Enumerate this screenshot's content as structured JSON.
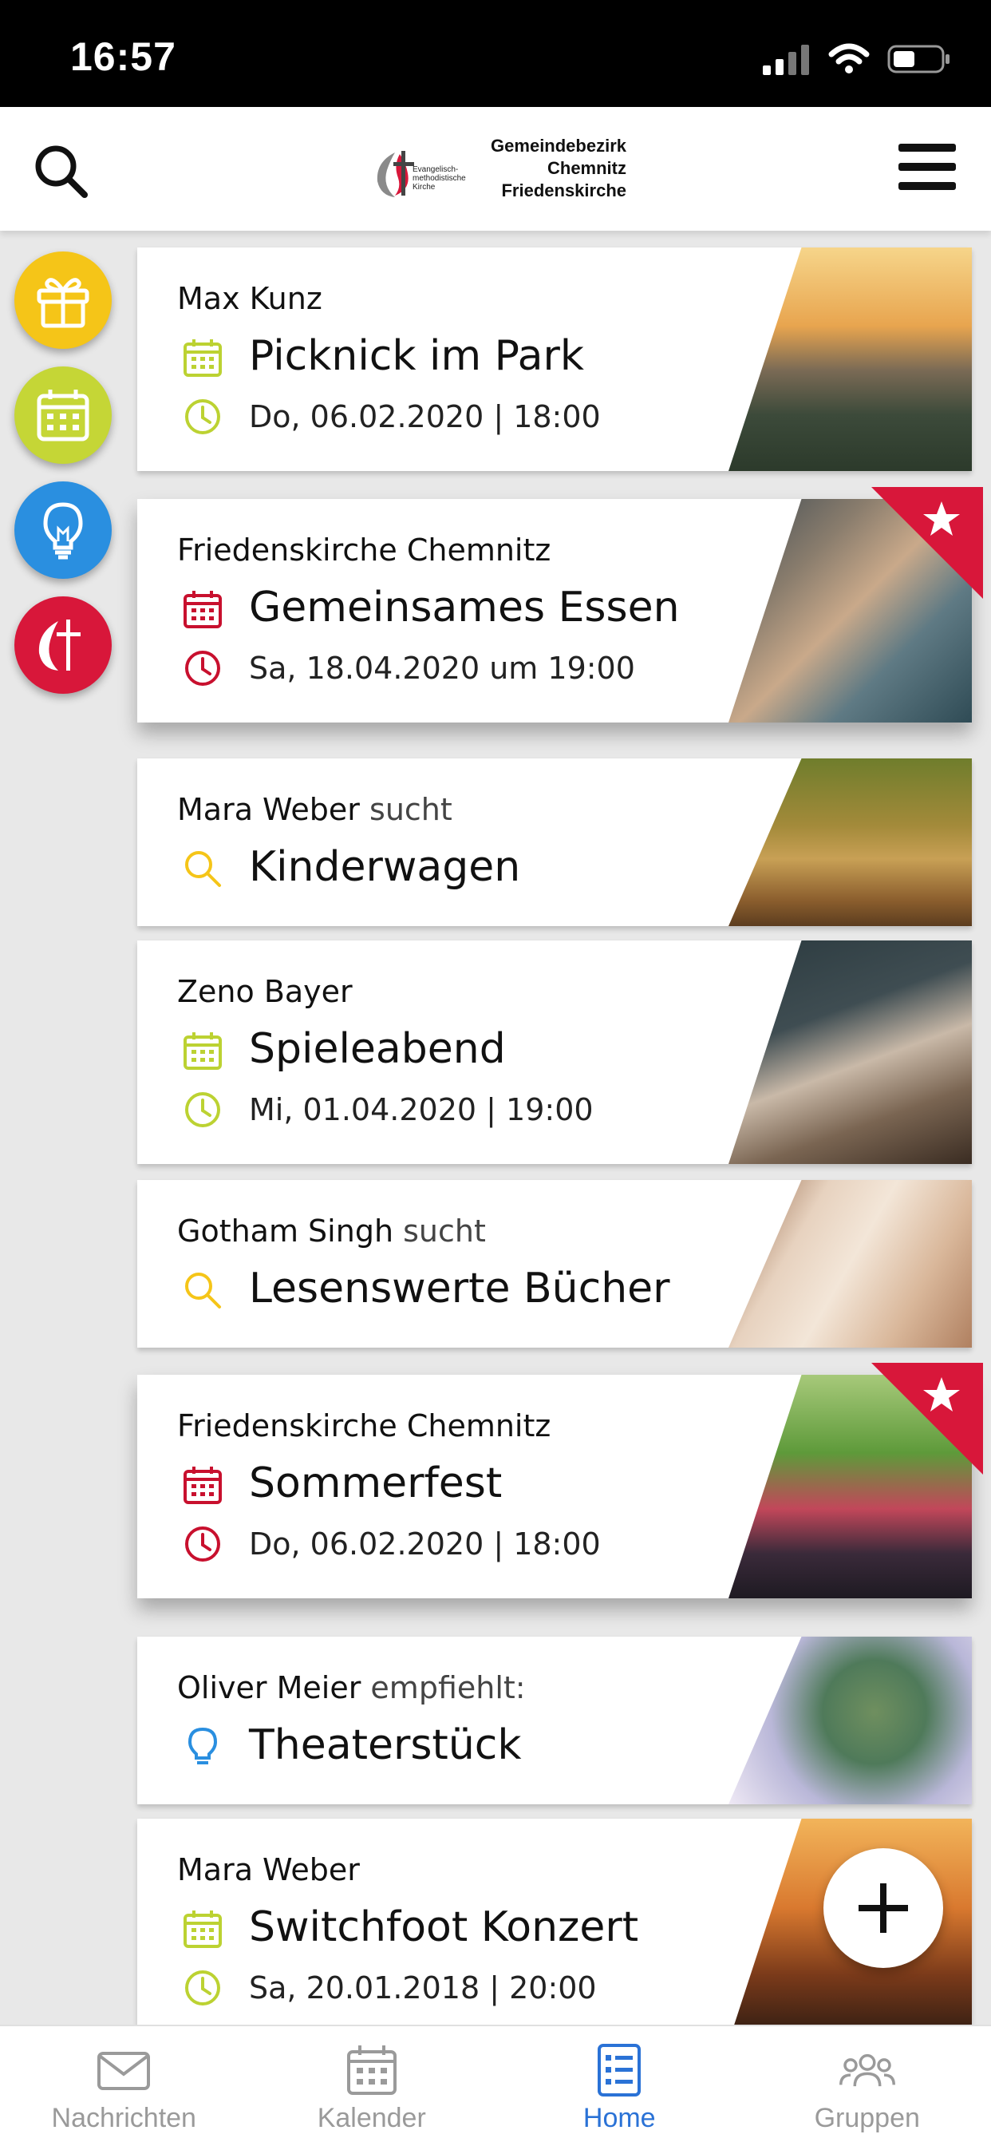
{
  "status": {
    "time": "16:57"
  },
  "header": {
    "logo_small": "Evangelisch-methodistische Kirche",
    "logo_line1": "Gemeindebezirk",
    "logo_line2": "Chemnitz",
    "logo_line3": "Friedenskirche"
  },
  "sidebar": {
    "items": [
      {
        "icon": "gift-icon",
        "color": "#f5c518"
      },
      {
        "icon": "calendar-icon",
        "color": "#c5d636"
      },
      {
        "icon": "lightbulb-icon",
        "color": "#2a8fe0"
      },
      {
        "icon": "church-cross-icon",
        "color": "#d8173a"
      }
    ]
  },
  "colors": {
    "lime": "#bcd232",
    "red": "#c8102e",
    "yellow": "#f5c518",
    "blue": "#2a8fe0",
    "accent": "#2a72d6"
  },
  "feed": [
    {
      "author": "Max Kunz",
      "verb": "",
      "title": "Picknick im Park",
      "date": "Do, 06.02.2020 | 18:00",
      "kind": "event",
      "color": "lime",
      "featured": false
    },
    {
      "author": "Friedenskirche Chemnitz",
      "verb": "",
      "title": "Gemeinsames Essen",
      "date": "Sa, 18.04.2020 um 19:00",
      "kind": "event",
      "color": "red",
      "featured": true
    },
    {
      "author": "Mara Weber",
      "verb": "sucht",
      "title": "Kinderwagen",
      "date": "",
      "kind": "search"
    },
    {
      "author": "Zeno Bayer",
      "verb": "",
      "title": "Spieleabend",
      "date": "Mi, 01.04.2020 | 19:00",
      "kind": "event",
      "color": "lime",
      "featured": false
    },
    {
      "author": "Gotham Singh",
      "verb": "sucht",
      "title": "Lesenswerte Bücher",
      "date": "",
      "kind": "search"
    },
    {
      "author": "Friedenskirche Chemnitz",
      "verb": "",
      "title": "Sommerfest",
      "date": "Do, 06.02.2020 | 18:00",
      "kind": "event",
      "color": "red",
      "featured": true
    },
    {
      "author": "Oliver Meier",
      "verb": "empfiehlt:",
      "title": "Theaterstück",
      "date": "",
      "kind": "tip"
    },
    {
      "author": "Mara Weber",
      "verb": "",
      "title": "Switchfoot Konzert",
      "date": "Sa, 20.01.2018 | 20:00",
      "kind": "event",
      "color": "lime",
      "featured": false
    }
  ],
  "tabs": [
    {
      "label": "Nachrichten",
      "icon": "mail-icon",
      "active": false
    },
    {
      "label": "Kalender",
      "icon": "calendar-icon",
      "active": false
    },
    {
      "label": "Home",
      "icon": "list-icon",
      "active": true
    },
    {
      "label": "Gruppen",
      "icon": "group-icon",
      "active": false
    }
  ]
}
